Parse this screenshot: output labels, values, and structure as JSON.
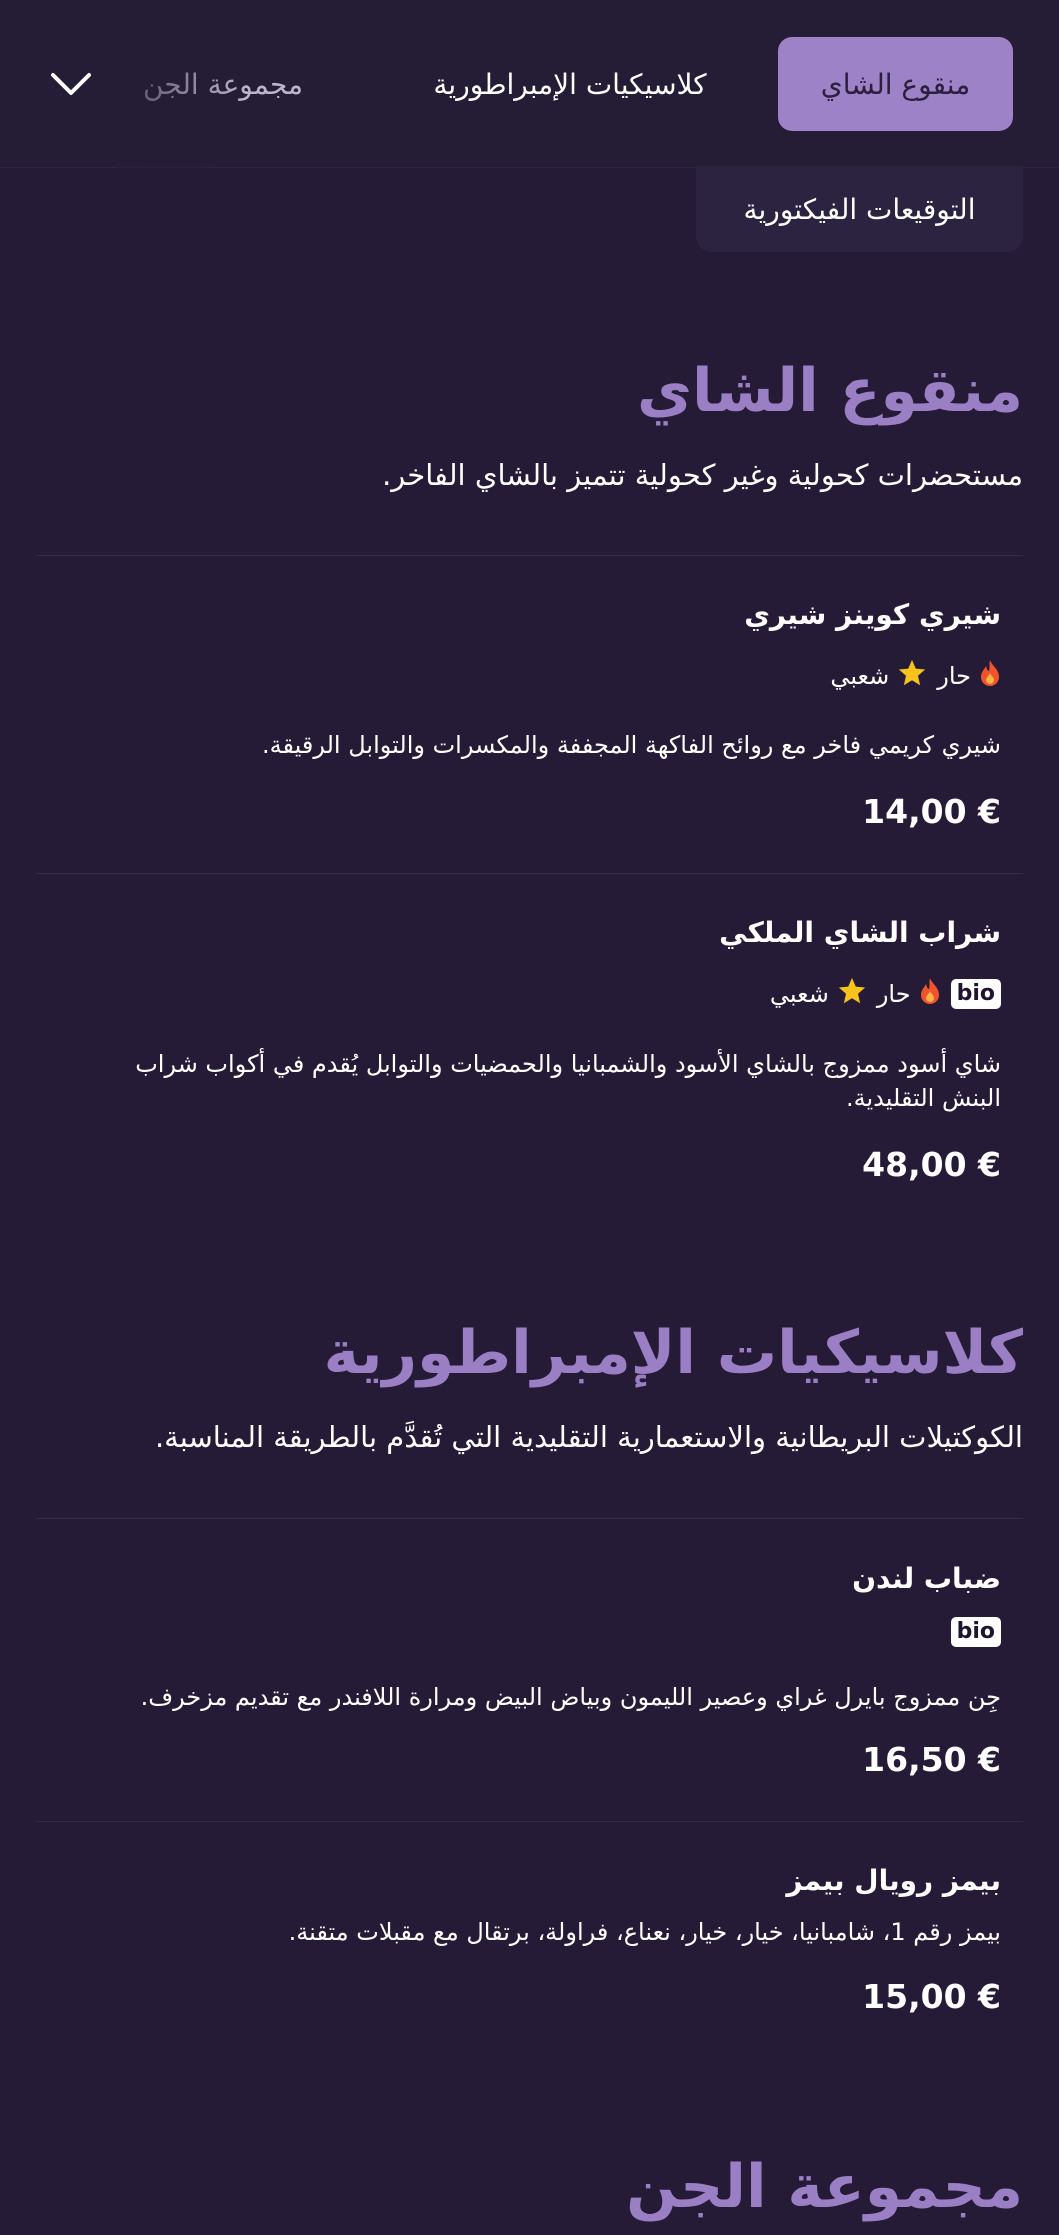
{
  "nav": {
    "tabs": [
      {
        "label": "منقوع الشاي",
        "active": true
      },
      {
        "label": "كلاسيكيات الإمبراطورية",
        "active": false
      },
      {
        "label": "مجموعة الجن",
        "active": false
      }
    ],
    "dropdown_item": "التوقيعات الفيكتورية",
    "toggle_icon": "chevron-down-icon"
  },
  "tag_labels": {
    "hot": "حار",
    "popular": "شعبي",
    "bio": "bio"
  },
  "icons": {
    "hot": "flame-icon",
    "popular": "star-icon"
  },
  "colors": {
    "background": "#261b37",
    "accent": "#9d82c8",
    "heading": "#9a7fc5",
    "flame": "#f0542a",
    "star": "#f6c31c"
  },
  "sections": [
    {
      "title": "منقوع الشاي",
      "description": "مستحضرات كحولية وغير كحولية تتميز بالشاي الفاخر.",
      "items": [
        {
          "name": "شيري كوينز شيري",
          "tags": [
            "hot",
            "popular"
          ],
          "description": "شيري كريمي فاخر مع روائح الفاكهة المجففة والمكسرات والتوابل الرقيقة.",
          "price": "14,00 €"
        },
        {
          "name": "شراب الشاي الملكي",
          "tags": [
            "bio",
            "hot",
            "popular"
          ],
          "description": "شاي أسود ممزوج بالشاي الأسود والشمبانيا والحمضيات والتوابل يُقدم في أكواب شراب البنش التقليدية.",
          "price": "48,00 €"
        }
      ]
    },
    {
      "title": "كلاسيكيات الإمبراطورية",
      "description": "الكوكتيلات البريطانية والاستعمارية التقليدية التي تُقدَّم بالطريقة المناسبة.",
      "items": [
        {
          "name": "ضباب لندن",
          "tags": [
            "bio"
          ],
          "description": "جِن ممزوج بايرل غراي وعصير الليمون وبياض البيض ومرارة اللافندر مع تقديم مزخرف.",
          "price": "16,50 €"
        },
        {
          "name": "بيمز رويال بيمز",
          "tags": [],
          "description": "بيمز رقم 1، شامبانيا، خيار، خيار، نعناع، فراولة، برتقال مع مقبلات متقنة.",
          "price": "15,00 €"
        }
      ]
    },
    {
      "title": "مجموعة الجن"
    }
  ]
}
